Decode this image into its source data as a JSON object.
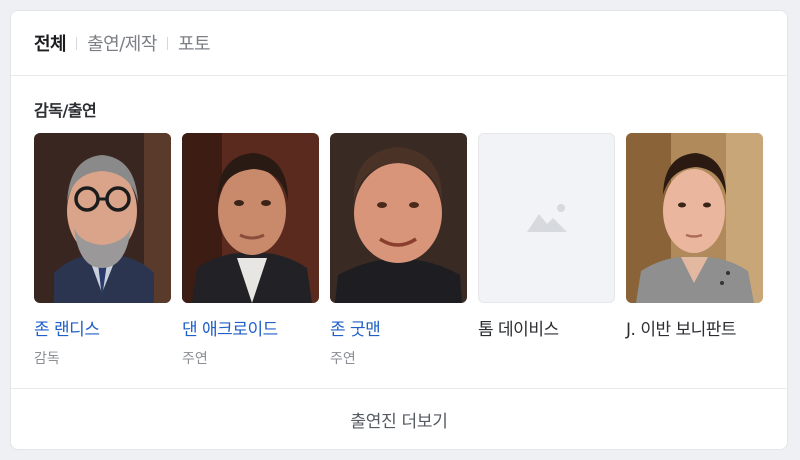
{
  "tabs": [
    {
      "label": "전체",
      "active": true
    },
    {
      "label": "출연/제작",
      "active": false
    },
    {
      "label": "포토",
      "active": false
    }
  ],
  "section_title": "감독/출연",
  "people": [
    {
      "name": "존 랜디스",
      "role": "감독",
      "photo": "photo"
    },
    {
      "name": "댄 애크로이드",
      "role": "주연",
      "photo": "photo"
    },
    {
      "name": "존 굿맨",
      "role": "주연",
      "photo": "photo"
    },
    {
      "name": "톰 데이비스",
      "role": "",
      "photo": "placeholder-image-icon"
    },
    {
      "name": "J. 이반 보니판트",
      "role": "",
      "photo": "photo"
    }
  ],
  "more_label": "출연진 더보기",
  "colors": {
    "link": "#1f5fc8",
    "card_bg": "#ffffff",
    "page_bg": "#eef0f3"
  }
}
